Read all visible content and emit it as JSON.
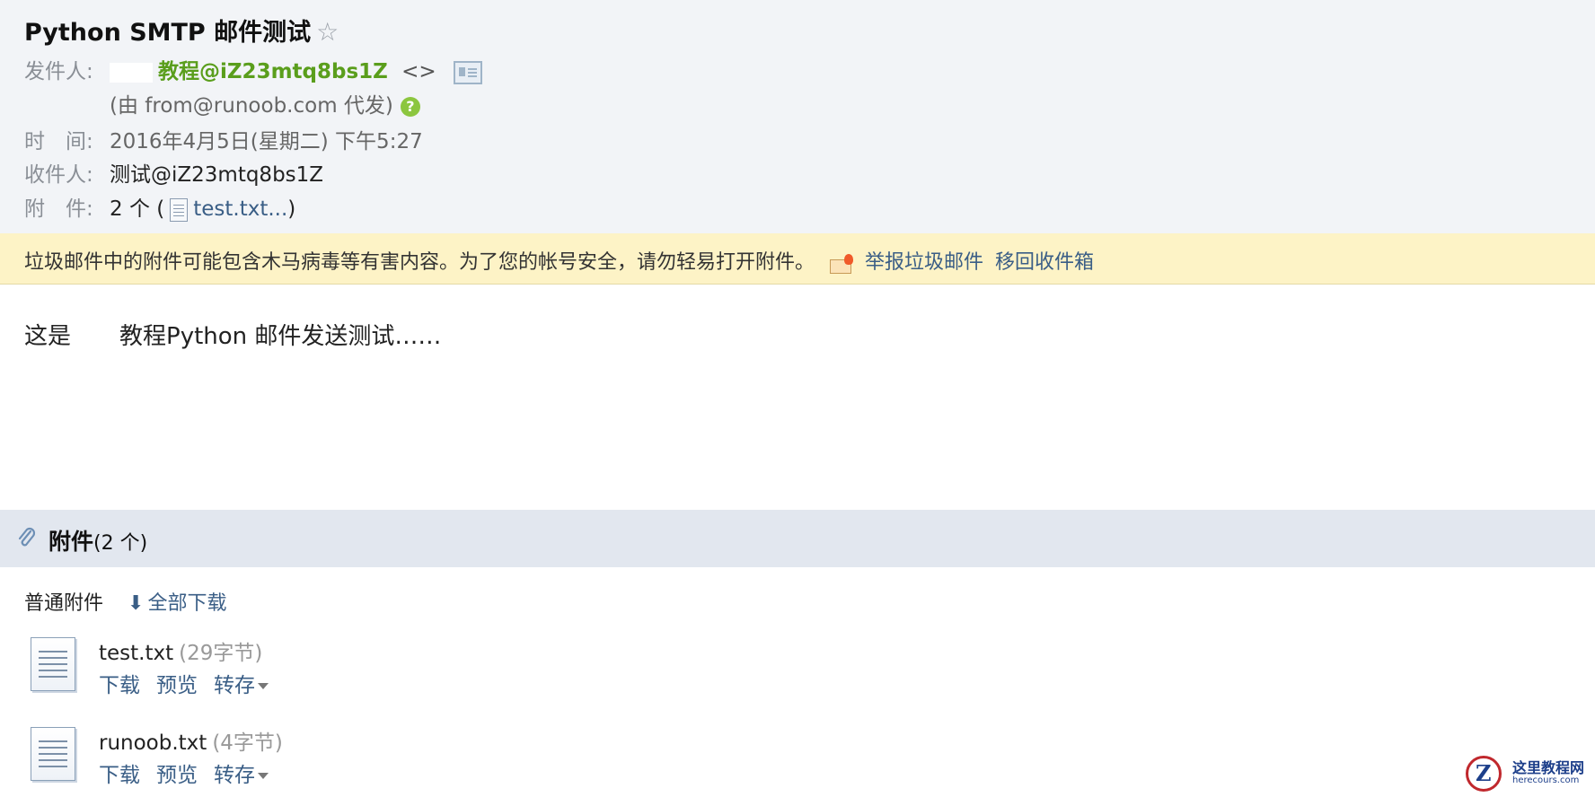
{
  "email": {
    "subject": "Python SMTP 邮件测试",
    "star": "☆",
    "from_label": "发件人:",
    "from_name": "教程@iZ23mtq8bs1Z",
    "from_addr": "<>",
    "via_text": "(由 from@runoob.com 代发)",
    "help": "?",
    "time_label": "时　间:",
    "time_value": "2016年4月5日(星期二) 下午5:27",
    "to_label": "收件人:",
    "to_value": "测试@iZ23mtq8bs1Z",
    "att_label": "附　件:",
    "att_count_prefix": "2 个 (",
    "att_link": "test.txt...",
    "att_suffix": ")"
  },
  "warning": {
    "text": "垃圾邮件中的附件可能包含木马病毒等有害内容。为了您的帐号安全，请勿轻易打开附件。",
    "report": "举报垃圾邮件",
    "move": "移回收件箱"
  },
  "body": {
    "prefix": "这是",
    "text": "教程Python 邮件发送测试……"
  },
  "attachments": {
    "title": "附件",
    "count": "(2 个)",
    "section": "普通附件",
    "download_all": "全部下载",
    "files": [
      {
        "name": "test.txt",
        "size": "(29字节)",
        "download": "下载",
        "preview": "预览",
        "save": "转存"
      },
      {
        "name": "runoob.txt",
        "size": "(4字节)",
        "download": "下载",
        "preview": "预览",
        "save": "转存"
      }
    ]
  },
  "logo": {
    "title": "这里教程网",
    "url": "herecours.com"
  },
  "colors": {
    "header_bg": "#f2f4f7",
    "warning_bg": "#fdf3c6",
    "sender_green": "#5a9e1c",
    "link_blue": "#3a5e86",
    "attach_bar": "#e2e7ef"
  }
}
